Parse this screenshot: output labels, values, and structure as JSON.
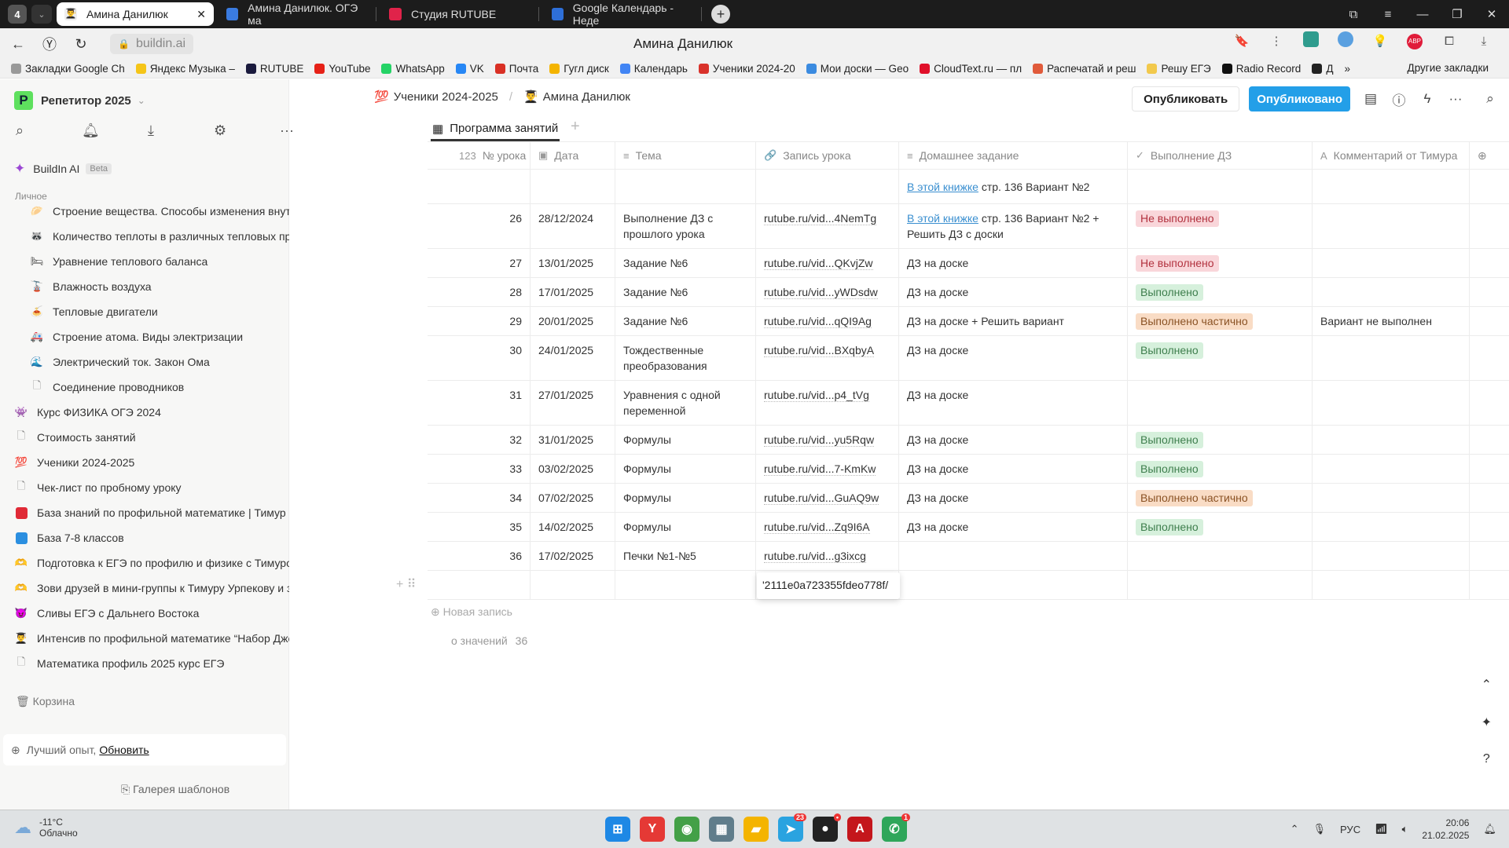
{
  "browser": {
    "tab_count": "4",
    "tabs": [
      {
        "label": "Амина Данилюк",
        "active": true,
        "icon_color": "#fff"
      },
      {
        "label": "Амина Данилюк. ОГЭ ма",
        "active": false,
        "icon_color": "#3a7be0"
      },
      {
        "label": "Студия RUTUBE",
        "active": false,
        "icon_color": "#e0234a"
      },
      {
        "label": "Google Календарь - Неде",
        "active": false,
        "icon_color": "#2e6fd8"
      }
    ],
    "url": "buildin.ai",
    "page_title": "Амина Данилюк",
    "bookmarks": [
      {
        "label": "Закладки Google Ch",
        "color": "#999"
      },
      {
        "label": "Яндекс Музыка –",
        "color": "#f5c518"
      },
      {
        "label": "RUTUBE",
        "color": "#1a1a3d"
      },
      {
        "label": "YouTube",
        "color": "#e62117"
      },
      {
        "label": "WhatsApp",
        "color": "#25d366"
      },
      {
        "label": "VK",
        "color": "#2787f5"
      },
      {
        "label": "Почта",
        "color": "#d93025"
      },
      {
        "label": "Гугл диск",
        "color": "#f4b400"
      },
      {
        "label": "Календарь",
        "color": "#4285f4"
      },
      {
        "label": "Ученики 2024-20",
        "color": "#d9322b"
      },
      {
        "label": "Мои доски — Geo",
        "color": "#3b8be0"
      },
      {
        "label": "CloudText.ru — пл",
        "color": "#e0102a"
      },
      {
        "label": "Распечатай и реш",
        "color": "#e05a3a"
      },
      {
        "label": "Решу ЕГЭ",
        "color": "#f2c94c"
      },
      {
        "label": "Radio Record",
        "color": "#111"
      },
      {
        "label": "Д",
        "color": "#222"
      }
    ],
    "bookmarks_more": "»",
    "other_bookmarks": "Другие закладки"
  },
  "sidebar": {
    "workspace_letter": "Р",
    "workspace_name": "Репетитор 2025",
    "ai_label": "BuildIn AI",
    "ai_badge": "Beta",
    "section_label": "Личное",
    "items": [
      {
        "label": "Строение вещества. Способы изменения внутренн...",
        "level": "child",
        "icon": "🥟"
      },
      {
        "label": "Количество теплоты в различных тепловых проце...",
        "level": "child",
        "icon": "🦝"
      },
      {
        "label": "Уравнение теплового баланса",
        "level": "child",
        "icon": "🛏"
      },
      {
        "label": "Влажность воздуха",
        "level": "child",
        "icon": "🚡"
      },
      {
        "label": "Тепловые двигатели",
        "level": "child",
        "icon": "🍝"
      },
      {
        "label": "Строение атома. Виды электризации",
        "level": "child",
        "icon": "🚑"
      },
      {
        "label": "Электрический ток. Закон Ома",
        "level": "child",
        "icon": "🌊"
      },
      {
        "label": "Соединение проводников",
        "level": "child",
        "icon": "📄"
      },
      {
        "label": "Курс ФИЗИКА ОГЭ 2024",
        "level": "top",
        "icon": "👾"
      },
      {
        "label": "Стоимость занятий",
        "level": "top",
        "icon": "📄"
      },
      {
        "label": "Ученики 2024-2025",
        "level": "top",
        "icon": "💯"
      },
      {
        "label": "Чек-лист по пробному уроку",
        "level": "top",
        "icon": "📄"
      },
      {
        "label": "База знаний по профильной математике | Тимур Урп...",
        "level": "top",
        "icon": "red-square"
      },
      {
        "label": "База 7-8 классов",
        "level": "top",
        "icon": "blue-square"
      },
      {
        "label": "Подготовка к ЕГЭ по профилю и физике с Тимуром У...",
        "level": "top",
        "icon": "🫶"
      },
      {
        "label": "Зови друзей в мини-группы к Тимуру Урпекову и зар...",
        "level": "top",
        "icon": "🫶"
      },
      {
        "label": "Сливы ЕГЭ с Дальнего Востока",
        "level": "top",
        "icon": "😈"
      },
      {
        "label": "Интенсив по профильной математике “Набор Джент...",
        "level": "top",
        "icon": "👨‍🎓"
      },
      {
        "label": "Математика профиль 2025 курс ЕГЭ",
        "level": "top",
        "icon": "📄"
      }
    ],
    "trash_label": "Корзина",
    "upgrade_text": "Лучший опыт,",
    "upgrade_link": "Обновить",
    "gallery_label": "Галерея шаблонов"
  },
  "header": {
    "breadcrumb": [
      {
        "icon": "💯",
        "label": "Ученики 2024-2025"
      },
      {
        "icon": "👨‍🎓",
        "label": "Амина Данилюк"
      }
    ],
    "publish_label": "Опубликовать",
    "published_label": "Опубликовано"
  },
  "view": {
    "tab_label": "Программа занятий"
  },
  "table": {
    "columns": [
      {
        "label": "№ урока",
        "icon": "123"
      },
      {
        "label": "Дата",
        "icon": "▣"
      },
      {
        "label": "Тема",
        "icon": "≡"
      },
      {
        "label": "Запись урока",
        "icon": "🔗"
      },
      {
        "label": "Домашнее задание",
        "icon": "≡"
      },
      {
        "label": "Выполнение ДЗ",
        "icon": "✓"
      },
      {
        "label": "Комментарий от Тимура",
        "icon": "A"
      }
    ],
    "rows": [
      {
        "num": "",
        "date": "",
        "topic": "",
        "video": "",
        "hw_link": "В этой книжке",
        "hw": " стр. 136 Вариант №2",
        "status": "",
        "status_type": "",
        "comment": ""
      },
      {
        "num": "26",
        "date": "28/12/2024",
        "topic": "Выполнение ДЗ с прошлого урока",
        "video": "rutube.ru/vid...4NemTg",
        "hw_link": "В этой книжке",
        "hw": " стр. 136 Вариант №2 + Решить ДЗ с доски",
        "status": "Не выполнено",
        "status_type": "red",
        "comment": ""
      },
      {
        "num": "27",
        "date": "13/01/2025",
        "topic": "Задание №6",
        "video": "rutube.ru/vid...QKvjZw",
        "hw_link": "",
        "hw": "ДЗ на доске",
        "status": "Не выполнено",
        "status_type": "red",
        "comment": ""
      },
      {
        "num": "28",
        "date": "17/01/2025",
        "topic": "Задание №6",
        "video": "rutube.ru/vid...yWDsdw",
        "hw_link": "",
        "hw": "ДЗ на доске",
        "status": "Выполнено",
        "status_type": "green",
        "comment": ""
      },
      {
        "num": "29",
        "date": "20/01/2025",
        "topic": "Задание №6",
        "video": "rutube.ru/vid...qQI9Ag",
        "hw_link": "",
        "hw": "ДЗ на доске + Решить вариант",
        "status": "Выполнено частично",
        "status_type": "orange",
        "comment": "Вариант не выполнен"
      },
      {
        "num": "30",
        "date": "24/01/2025",
        "topic": "Тождественные преобразования",
        "video": "rutube.ru/vid...BXqbyA",
        "hw_link": "",
        "hw": "ДЗ на доске",
        "status": "Выполнено",
        "status_type": "green",
        "comment": ""
      },
      {
        "num": "31",
        "date": "27/01/2025",
        "topic": "Уравнения с одной переменной",
        "video": "rutube.ru/vid...p4_tVg",
        "hw_link": "",
        "hw": "ДЗ на доске",
        "status": "",
        "status_type": "",
        "comment": ""
      },
      {
        "num": "32",
        "date": "31/01/2025",
        "topic": "Формулы",
        "video": "rutube.ru/vid...yu5Rqw",
        "hw_link": "",
        "hw": "ДЗ на доске",
        "status": "Выполнено",
        "status_type": "green",
        "comment": ""
      },
      {
        "num": "33",
        "date": "03/02/2025",
        "topic": "Формулы",
        "video": "rutube.ru/vid...7-KmKw",
        "hw_link": "",
        "hw": "ДЗ на доске",
        "status": "Выполнено",
        "status_type": "green",
        "comment": ""
      },
      {
        "num": "34",
        "date": "07/02/2025",
        "topic": "Формулы",
        "video": "rutube.ru/vid...GuAQ9w",
        "hw_link": "",
        "hw": "ДЗ на доске",
        "status": "Выполнено частично",
        "status_type": "orange",
        "comment": ""
      },
      {
        "num": "35",
        "date": "14/02/2025",
        "topic": "Формулы",
        "video": "rutube.ru/vid...Zq9I6A",
        "hw_link": "",
        "hw": "ДЗ на доске",
        "status": "Выполнено",
        "status_type": "green",
        "comment": ""
      },
      {
        "num": "36",
        "date": "17/02/2025",
        "topic": "Печки №1-№5",
        "video": "rutube.ru/vid...g3ixcg",
        "hw_link": "",
        "hw": "",
        "status": "",
        "status_type": "",
        "comment": ""
      },
      {
        "num": "",
        "date": "",
        "topic": "",
        "video": "",
        "hw_link": "",
        "hw": "",
        "status": "",
        "status_type": "",
        "comment": ""
      }
    ],
    "editing_value": "'2111e0a723355fdeo778f/",
    "new_record_label": "Новая запись",
    "count_label": "о значений",
    "count_value": "36"
  },
  "status_colors": {
    "red": "#f9d6da",
    "green": "#d6f0dc",
    "orange": "#f9dcc5",
    "accent": "#239fe8"
  },
  "taskbar": {
    "temperature": "-11°C",
    "weather": "Облачно",
    "apps": [
      {
        "name": "start",
        "glyph": "⊞",
        "color": "#1e88e5"
      },
      {
        "name": "yandex-browser",
        "glyph": "Y",
        "color": "#e53935"
      },
      {
        "name": "chrome",
        "glyph": "◉",
        "color": "#43a047"
      },
      {
        "name": "calculator",
        "glyph": "▦",
        "color": "#607d8b"
      },
      {
        "name": "explorer",
        "glyph": "▰",
        "color": "#f4b400"
      },
      {
        "name": "telegram",
        "glyph": "➤",
        "color": "#2aa3e0",
        "badge": "23"
      },
      {
        "name": "obs",
        "glyph": "●",
        "color": "#222",
        "badge": "•"
      },
      {
        "name": "acrobat",
        "glyph": "A",
        "color": "#c4161c"
      },
      {
        "name": "whatsapp",
        "glyph": "✆",
        "color": "#2ea65a",
        "badge": "1"
      }
    ],
    "language": "РУС",
    "time": "20:06",
    "date": "21.02.2025"
  }
}
